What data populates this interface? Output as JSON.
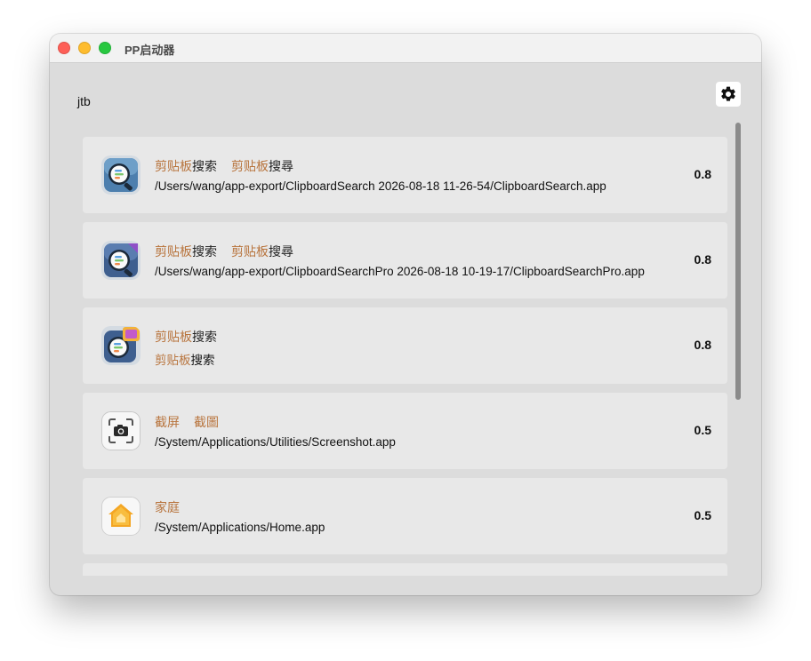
{
  "window": {
    "title": "PP启动器"
  },
  "search": {
    "query": "jtb"
  },
  "results": [
    {
      "name_hl": "剪贴板",
      "name_rest": "搜索",
      "name2_hl": "剪贴板",
      "name2_rest": "搜尋",
      "path_hl": "",
      "path_rest": "/Users/wang/app-export/ClipboardSearch 2026-08-18 11-26-54/ClipboardSearch.app",
      "score": "0.8",
      "icon": "clipboard-search-icon"
    },
    {
      "name_hl": "剪贴板",
      "name_rest": "搜索",
      "name2_hl": "剪贴板",
      "name2_rest": "搜尋",
      "path_hl": "",
      "path_rest": "/Users/wang/app-export/ClipboardSearchPro 2026-08-18 10-19-17/ClipboardSearchPro.app",
      "score": "0.8",
      "icon": "clipboard-search-pro-icon"
    },
    {
      "name_hl": "剪贴板",
      "name_rest": "搜索",
      "name2_hl": "",
      "name2_rest": "",
      "path_hl": "剪贴板",
      "path_rest": "搜索",
      "score": "0.8",
      "icon": "clipboard-search-dev-icon"
    },
    {
      "name_hl": "截屏",
      "name_rest": "",
      "name2_hl": "截圖",
      "name2_rest": "",
      "path_hl": "",
      "path_rest": "/System/Applications/Utilities/Screenshot.app",
      "score": "0.5",
      "icon": "screenshot-icon"
    },
    {
      "name_hl": "家庭",
      "name_rest": "",
      "name2_hl": "",
      "name2_rest": "",
      "path_hl": "",
      "path_rest": "/System/Applications/Home.app",
      "score": "0.5",
      "icon": "home-icon"
    }
  ]
}
